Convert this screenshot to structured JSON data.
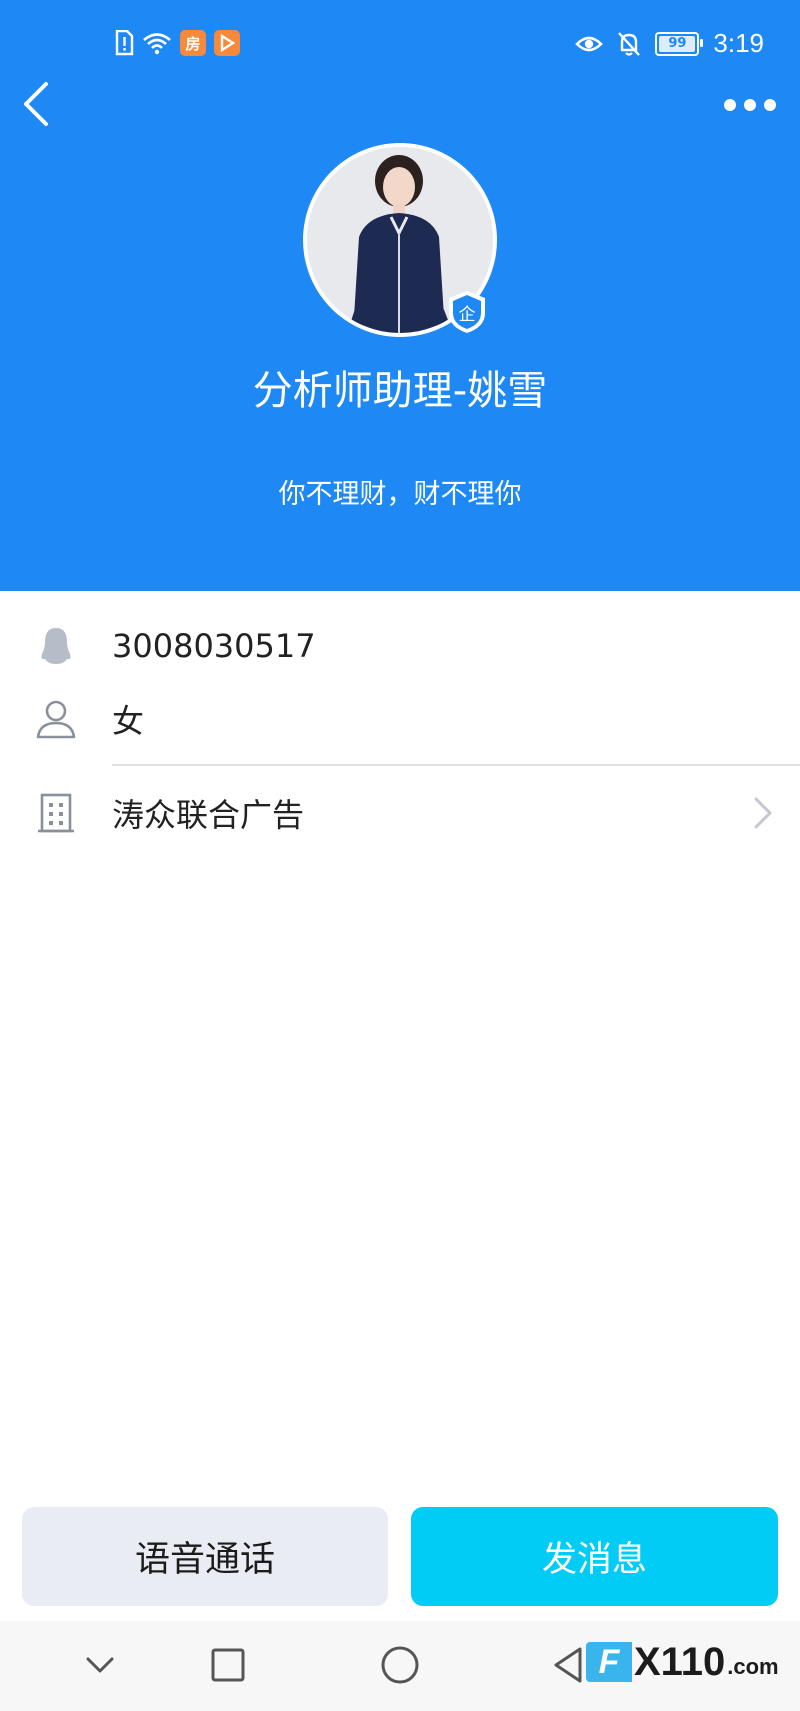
{
  "status_bar": {
    "badge_text": "房",
    "battery_level": "99",
    "time": "3:19"
  },
  "profile": {
    "name": "分析师助理-姚雪",
    "signature": "你不理财，财不理你",
    "corp_badge": "企"
  },
  "details": {
    "qq_number": "3008030517",
    "gender": "女",
    "company": "涛众联合广告"
  },
  "actions": {
    "voice_call_label": "语音通话",
    "send_message_label": "发消息"
  },
  "watermark": {
    "logo": "F",
    "number": "X110",
    "domain": ".com"
  },
  "colors": {
    "header_bg": "#1e88f5",
    "send_button": "#00ccf6",
    "voice_button": "#eaecf3"
  }
}
